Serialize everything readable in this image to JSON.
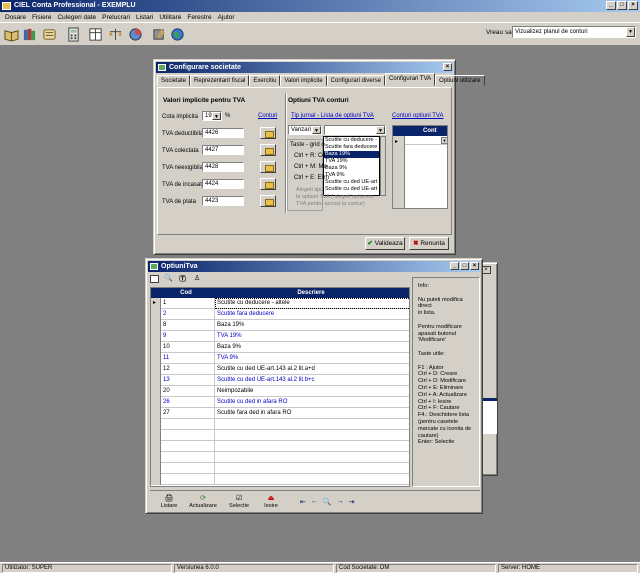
{
  "app": {
    "title": "CIEL Conta Professional - EXEMPLU"
  },
  "menu": [
    "Dosare",
    "Fisiere",
    "Culegeri date",
    "Prelucrari",
    "Listari",
    "Utilitare",
    "Ferestre",
    "Ajutor"
  ],
  "toolbar": {
    "vreau_label": "Vreau sa:",
    "vreau_value": "Vizualizez planul de conturi",
    "icons": [
      "open-book-icon",
      "books-icon",
      "scroll-icon",
      "calculator-icon",
      "ledger-icon",
      "balance-icon",
      "pie-chart-icon",
      "tools-icon",
      "library-icon",
      "globe-icon"
    ]
  },
  "config": {
    "title": "Configurare societate",
    "tabs": [
      "Societate",
      "Reprezentant fiscal",
      "Exercitiu",
      "Valori implicite",
      "Configurari diverse",
      "Configurari TVA",
      "Optiuni utilizare"
    ],
    "active_tab": "Configurari TVA",
    "left_section": "Valori implicite pentru TVA",
    "conturi_link": "Conturi",
    "cota_label": "Cota implicita",
    "cota_value": "19",
    "cota_unit": "%",
    "fields": [
      {
        "label": "TVA deductibila",
        "value": "4426"
      },
      {
        "label": "TVA colectata",
        "value": "4427"
      },
      {
        "label": "TVA neexigibila",
        "value": "4428"
      },
      {
        "label": "TVA de incasat",
        "value": "4424"
      },
      {
        "label": "TVA de plata",
        "value": "4423"
      }
    ],
    "right_section": "Optiuni TVA conturi",
    "tip_jurnal_link": "Tip jurnal - Lista de optiuni TVA",
    "conturi_optiuni_link": "Conturi optiuni TVA",
    "jurnal_value": "Vanzari",
    "cont_header": "Cont",
    "dropdown_items": [
      "Scutite cu deducere -",
      "Scutite fara deducere",
      "Baza 19%",
      "TVA 19%",
      "Baza 9%",
      "TVA 9%",
      "Scutite cu ded UE-art",
      "Scutite cu ded UE-art"
    ],
    "dropdown_selected": "Baza 19%",
    "taste_title": "Taste - grid o",
    "taste_lines": [
      "Ctrl + R: Ce",
      "Ctrl + M: Mo",
      "Ctrl + E: Elim"
    ],
    "hint_lines": [
      "Alegeti tipu",
      "la optiuni TVA ( alegeti optiunea",
      "TVA pentru accesi la contur)"
    ],
    "validate_label": "Valideaza",
    "cancel_label": "Renunta"
  },
  "optiuni": {
    "title": "OptiuniTva",
    "headers": [
      "Cod",
      "Descriere"
    ],
    "rows": [
      {
        "cod": "1",
        "descriere": "Scutite cu deducere - altele",
        "blue": false,
        "current": true
      },
      {
        "cod": "2",
        "descriere": "Scutite fara deducere",
        "blue": true,
        "current": false
      },
      {
        "cod": "8",
        "descriere": "Baza 19%",
        "blue": false,
        "current": false
      },
      {
        "cod": "9",
        "descriere": "TVA 19%",
        "blue": true,
        "current": false
      },
      {
        "cod": "10",
        "descriere": "Baza 9%",
        "blue": false,
        "current": false
      },
      {
        "cod": "11",
        "descriere": "TVA 9%",
        "blue": true,
        "current": false
      },
      {
        "cod": "12",
        "descriere": "Scutite cu ded UE-art.143 al.2 lit.a+d",
        "blue": false,
        "current": false
      },
      {
        "cod": "13",
        "descriere": "Scutite cu ded UE-art.143 al.2 lit.b+c",
        "blue": true,
        "current": false
      },
      {
        "cod": "20",
        "descriere": "Neimpozabile",
        "blue": false,
        "current": false
      },
      {
        "cod": "26",
        "descriere": "Scutite cu ded in afara RO",
        "blue": true,
        "current": false
      },
      {
        "cod": "27",
        "descriere": "Scutite fara ded in afara RO",
        "blue": false,
        "current": false
      }
    ],
    "info_lines": [
      "Info:",
      "",
      "Nu puteti modifica direct",
      "in lista.",
      "",
      "Pentru modificare",
      "apasati butonul",
      "'Modificare'",
      "",
      "Taste utile:",
      "",
      "F1 : Ajutor",
      "Ctrl + D: Creare",
      "Ctrl + D: Modificare",
      "Ctrl + E: Eliminare",
      "Ctrl + A: Actualizare",
      "Ctrl + I: Iesire",
      "Ctrl + F: Cautare",
      "F4.: Deschidere lista",
      "(pentru casetele",
      "marcate cu iconita de",
      "cautare)",
      "Enter: Selectie"
    ],
    "buttons": [
      "Listare",
      "Actualizare",
      "Selectie",
      "Iesire"
    ]
  },
  "status": {
    "user": "Utilizator: SUPER",
    "version": "Versiunea  6.0.0",
    "company": "Cod Societate: DM",
    "server": "Server: HOME"
  }
}
